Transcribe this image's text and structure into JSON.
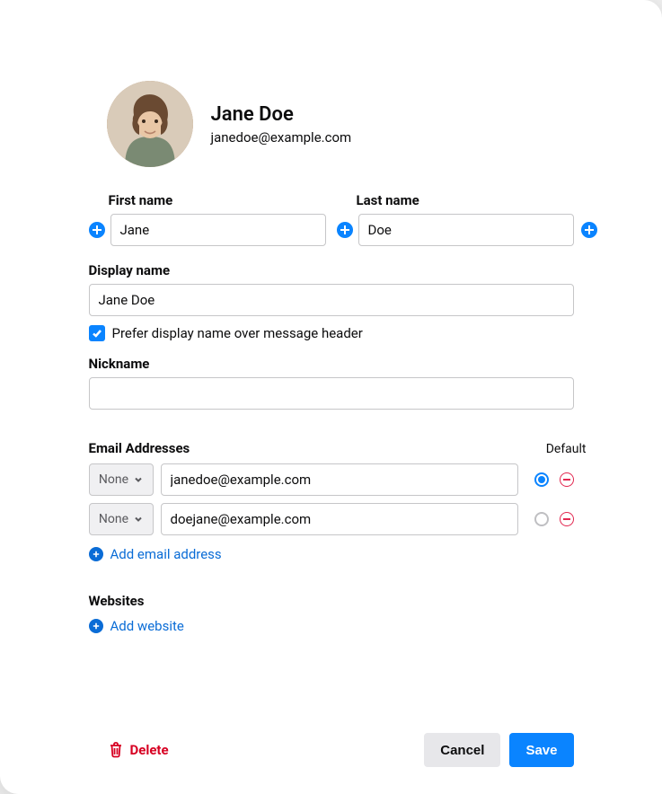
{
  "header": {
    "full_name": "Jane Doe",
    "email": "janedoe@example.com"
  },
  "fields": {
    "first_name_label": "First name",
    "first_name_value": "Jane",
    "last_name_label": "Last name",
    "last_name_value": "Doe",
    "display_name_label": "Display name",
    "display_name_value": "Jane Doe",
    "prefer_display_checked": true,
    "prefer_display_label": "Prefer display name over message header",
    "nickname_label": "Nickname",
    "nickname_value": ""
  },
  "emails": {
    "section_label": "Email Addresses",
    "default_header": "Default",
    "type_none_label": "None",
    "items": [
      {
        "value": "janedoe@example.com",
        "default": true
      },
      {
        "value": "doejane@example.com",
        "default": false
      }
    ],
    "add_label": "Add email address"
  },
  "websites": {
    "section_label": "Websites",
    "add_label": "Add website"
  },
  "footer": {
    "delete_label": "Delete",
    "cancel_label": "Cancel",
    "save_label": "Save"
  }
}
